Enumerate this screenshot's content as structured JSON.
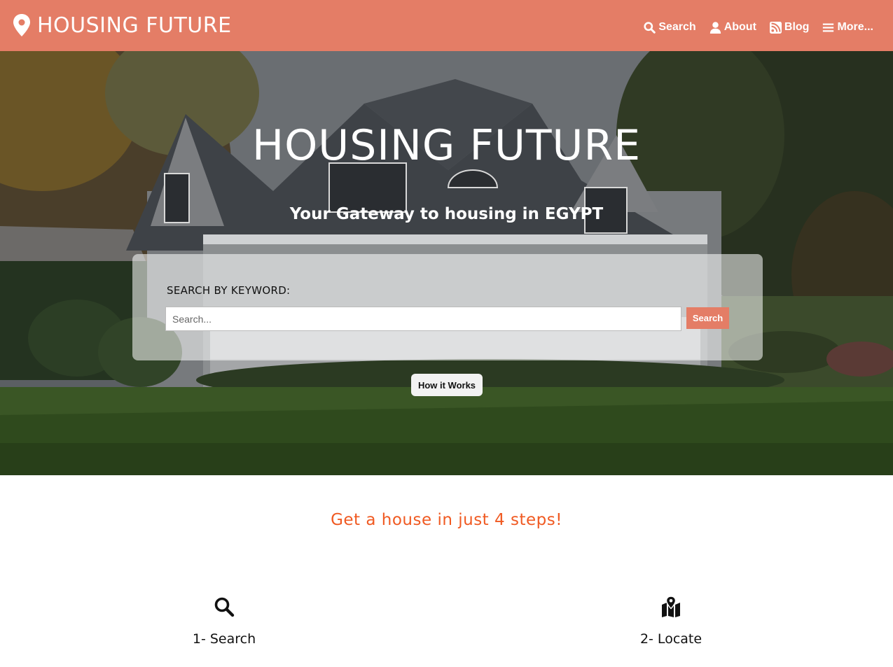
{
  "brand": {
    "title": "HOUSING FUTURE",
    "icon": "map-marker-icon"
  },
  "nav": [
    {
      "label": "Search",
      "icon": "search-icon"
    },
    {
      "label": "About",
      "icon": "user-icon"
    },
    {
      "label": "Blog",
      "icon": "rss-icon"
    },
    {
      "label": "More...",
      "icon": "menu-icon"
    }
  ],
  "hero": {
    "title": "HOUSING FUTURE",
    "subtitle": "Your Gateway to housing in EGYPT",
    "search_label": "SEARCH BY KEYWORD:",
    "search_placeholder": "Search...",
    "search_button": "Search",
    "how_button": "How it Works"
  },
  "steps": {
    "title": "Get a house in just 4 steps!",
    "items": [
      {
        "label": "1- Search",
        "icon": "search-icon"
      },
      {
        "label": "2- Locate",
        "icon": "map-location-icon"
      }
    ]
  },
  "colors": {
    "accent": "#e47d66",
    "steps_title": "#f05a22"
  }
}
